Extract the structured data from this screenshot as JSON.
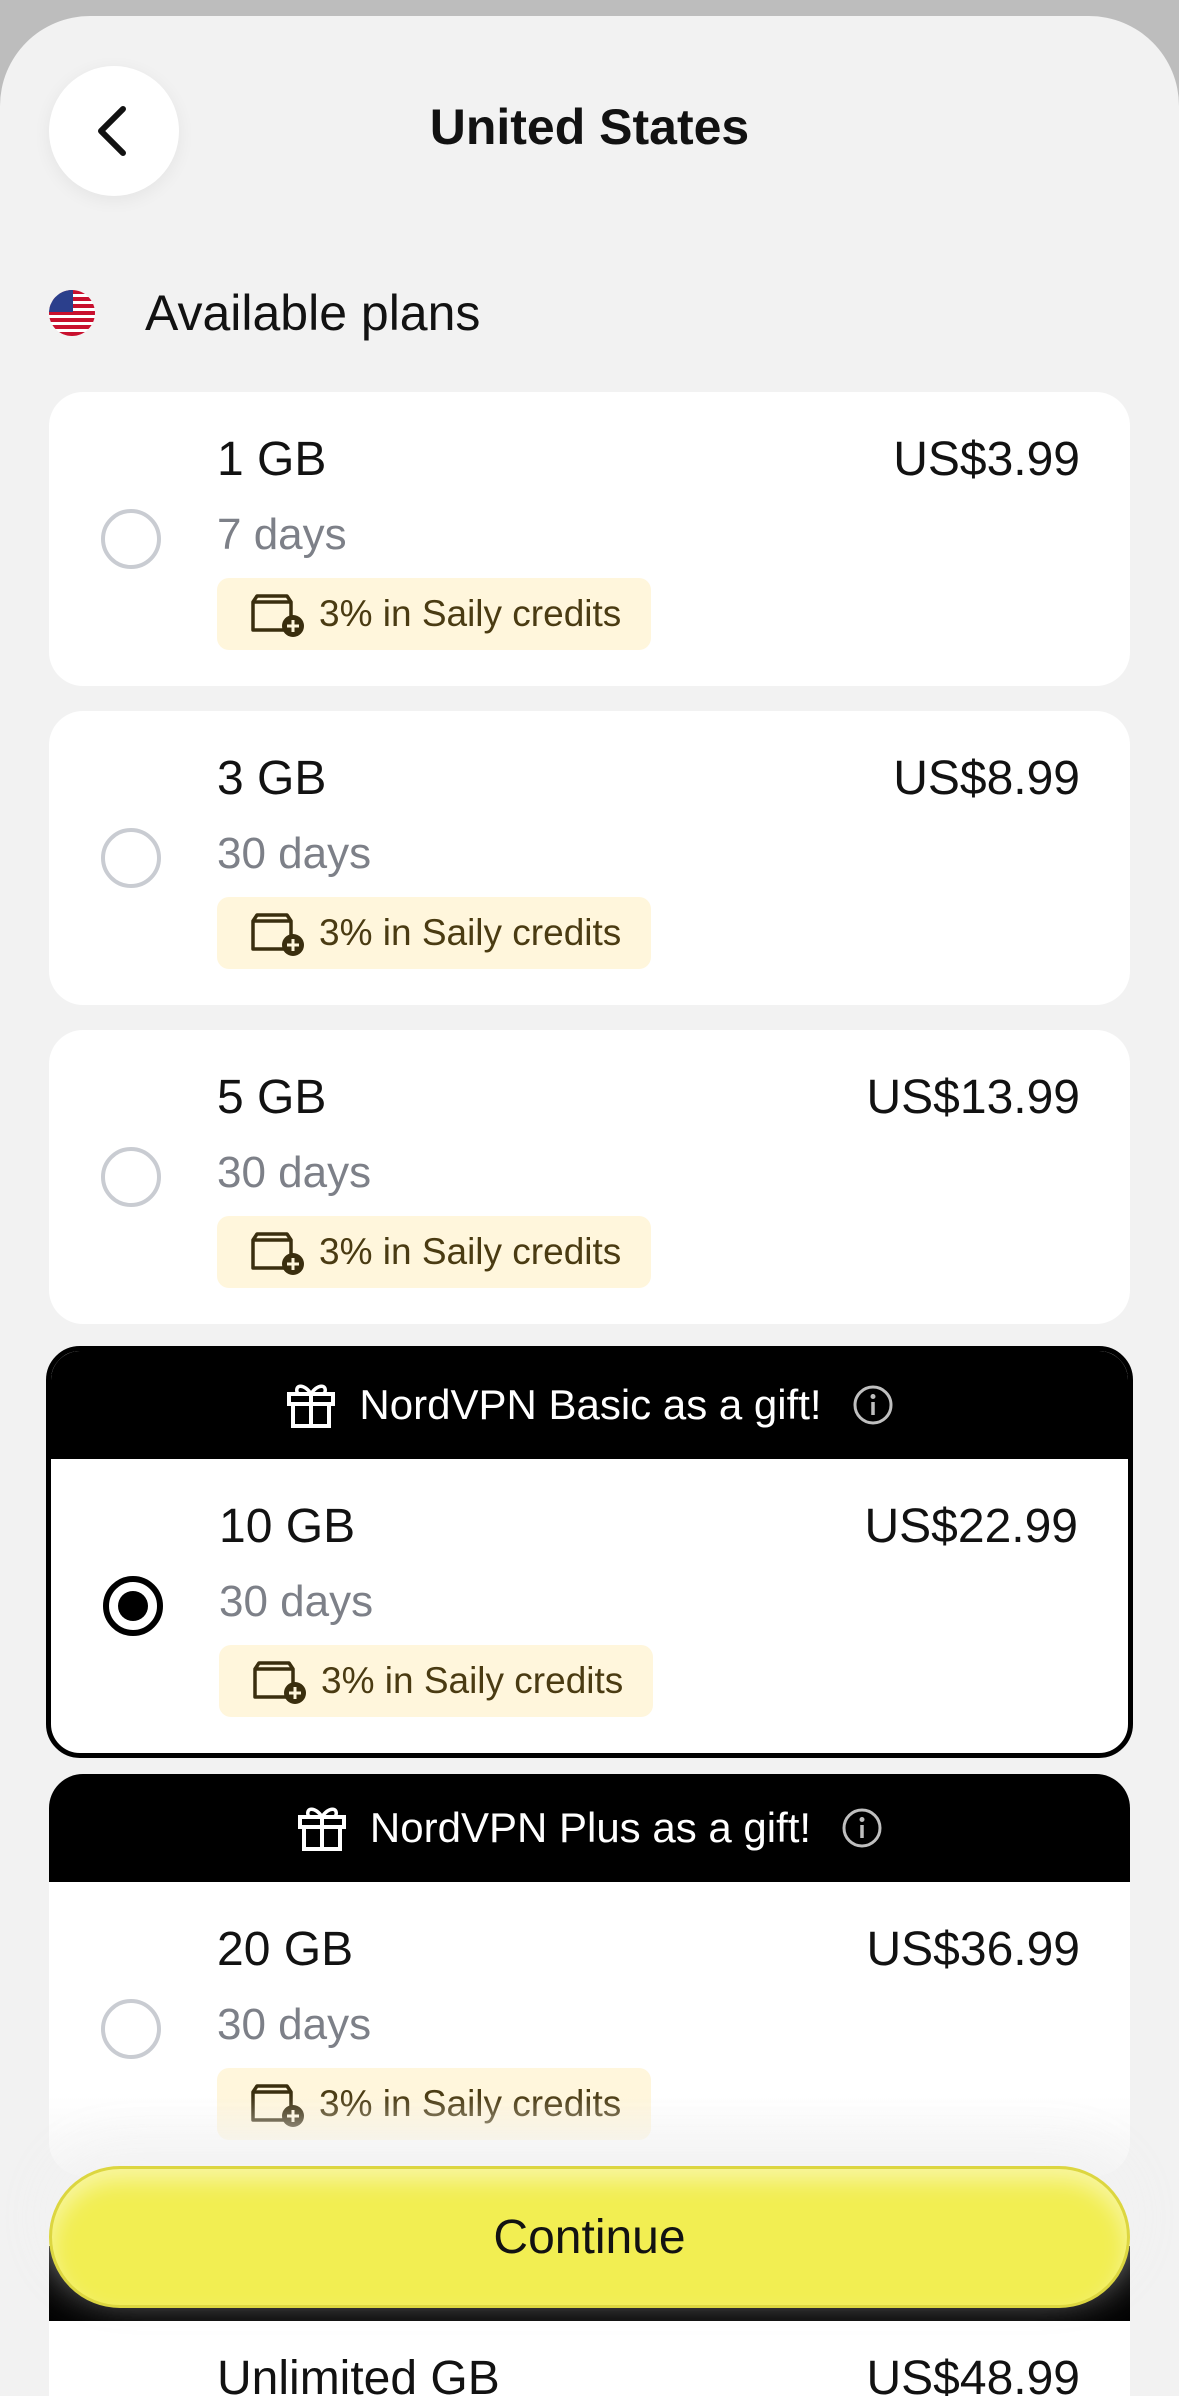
{
  "header": {
    "title": "United States"
  },
  "section": {
    "title": "Available plans"
  },
  "plans": [
    {
      "data": "1 GB",
      "duration": "7 days",
      "price": "US$3.99",
      "credits": "3% in Saily credits",
      "selected": false
    },
    {
      "data": "3 GB",
      "duration": "30 days",
      "price": "US$8.99",
      "credits": "3% in Saily credits",
      "selected": false
    },
    {
      "data": "5 GB",
      "duration": "30 days",
      "price": "US$13.99",
      "credits": "3% in Saily credits",
      "selected": false
    },
    {
      "gift": "NordVPN Basic as a gift!",
      "data": "10 GB",
      "duration": "30 days",
      "price": "US$22.99",
      "credits": "3% in Saily credits",
      "selected": true
    },
    {
      "gift": "NordVPN Plus as a gift!",
      "data": "20 GB",
      "duration": "30 days",
      "price": "US$36.99",
      "credits": "3% in Saily credits",
      "selected": false
    },
    {
      "data": "Unlimited GB",
      "price": "US$48.99"
    }
  ],
  "continue_label": "Continue",
  "colors": {
    "accent": "#f2ee52",
    "credits_bg": "#fff6dc",
    "gift_bar": "#000000"
  }
}
